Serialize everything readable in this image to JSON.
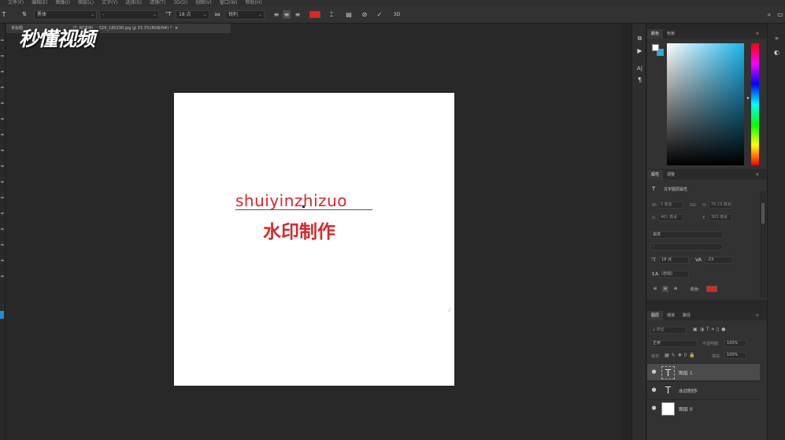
{
  "menu": {
    "items": [
      "文件(F)",
      "编辑(E)",
      "图像(I)",
      "图层(L)",
      "文字(Y)",
      "选择(S)",
      "滤镜(T)",
      "3D(D)",
      "视图(V)",
      "窗口(W)",
      "帮助(H)"
    ]
  },
  "options_bar": {
    "tool_icon": "T",
    "font_family": "黑体",
    "font_style": "-",
    "font_size": "18 点",
    "aa_label": "aa",
    "aa_mode": "锐利",
    "text_color": "#e8231d",
    "commit_icon": "✓",
    "cancel_icon": "⊘",
    "threed_label": "3D"
  },
  "doc_tab": {
    "left_label": "未标题",
    "mid_label": "(T, RGB/8)",
    "title": "526_180238.jpg @ 33.3%(RGB/8#) *",
    "close": "×"
  },
  "watermark": {
    "text": "秒懂视频"
  },
  "document": {
    "text_line1": "shuiyinzhizuo",
    "text_line2": "水印制作",
    "text_color": "#d9272a"
  },
  "strip_icons": [
    {
      "name": "history-icon",
      "glyph": "⧉"
    },
    {
      "name": "play-icon",
      "glyph": "▶"
    },
    {
      "name": "character-icon",
      "glyph": "A|"
    },
    {
      "name": "paragraph-icon",
      "glyph": "¶"
    }
  ],
  "color_panel": {
    "tabs": [
      "颜色",
      "色板"
    ],
    "fg_color": "#ffffff",
    "bg_color": "#1ab0e8",
    "menu": "≡"
  },
  "properties_panel": {
    "tabs": [
      "属性",
      "调整"
    ],
    "layer_kind": "文字图层属性",
    "w_label": "W:",
    "w_value": "0 像素",
    "h_label": "H:",
    "h_value": "76.19 像素",
    "x_label": "X:",
    "x_value": "461 像素",
    "y_label": "Y:",
    "y_value": "383 像素",
    "go_label": "GO",
    "font_family": "黑体",
    "font_style": "-",
    "font_size": "18 点",
    "tracking": "-23",
    "leading": "(自动)",
    "color_label": "颜色:",
    "color": "#e8231d"
  },
  "layers_panel": {
    "tabs": [
      "图层",
      "通道",
      "路径"
    ],
    "filter_label": "ρ 类型",
    "blend_mode": "正常",
    "opacity_label": "不透明度:",
    "opacity_value": "100%",
    "lock_label": "锁定:",
    "fill_label": "填充:",
    "fill_value": "100%",
    "layers": [
      {
        "name": "图层 1",
        "kind": "text",
        "selected": true,
        "thumb": "T"
      },
      {
        "name": "水印制作",
        "kind": "text",
        "selected": false,
        "thumb": "T"
      },
      {
        "name": "图层 0",
        "kind": "image",
        "selected": false,
        "thumb": ""
      }
    ],
    "eye_glyph": "●"
  }
}
